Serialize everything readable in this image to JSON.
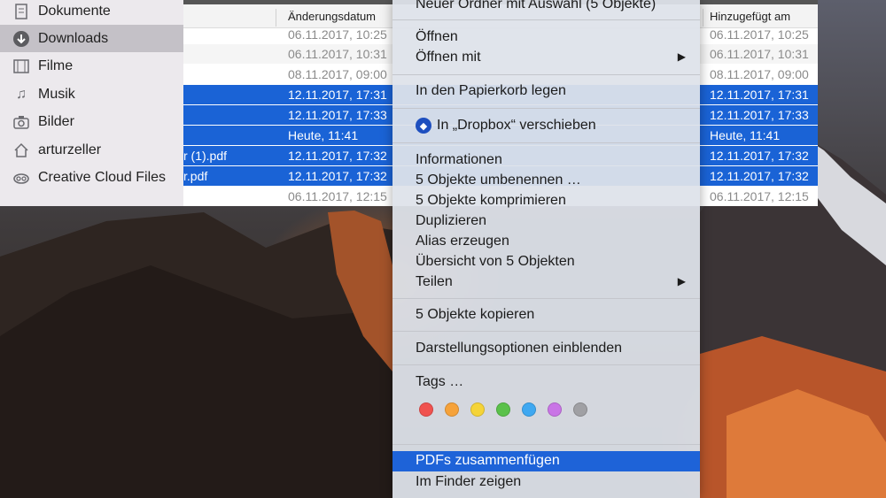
{
  "sidebar": {
    "items": [
      {
        "label": "Dokumente",
        "icon": "document-icon",
        "active": false
      },
      {
        "label": "Downloads",
        "icon": "download-icon",
        "active": true
      },
      {
        "label": "Filme",
        "icon": "film-icon",
        "active": false
      },
      {
        "label": "Musik",
        "icon": "music-icon",
        "active": false
      },
      {
        "label": "Bilder",
        "icon": "camera-icon",
        "active": false
      },
      {
        "label": "arturzeller",
        "icon": "home-icon",
        "active": false
      },
      {
        "label": "Creative Cloud Files",
        "icon": "creative-cloud-icon",
        "active": false
      }
    ]
  },
  "filelist": {
    "columns": {
      "modified": "Änderungsdatum",
      "added": "Hinzugefügt am"
    },
    "rows": [
      {
        "name": "",
        "modified": "06.11.2017, 10:25",
        "added": "06.11.2017, 10:25",
        "selected": false
      },
      {
        "name": "",
        "modified": "06.11.2017, 10:31",
        "added": "06.11.2017, 10:31",
        "selected": false
      },
      {
        "name": "",
        "modified": "08.11.2017, 09:00",
        "added": "08.11.2017, 09:00",
        "selected": false
      },
      {
        "name": "",
        "modified": "12.11.2017, 17:31",
        "added": "12.11.2017, 17:31",
        "selected": true
      },
      {
        "name": "",
        "modified": "12.11.2017, 17:33",
        "added": "12.11.2017, 17:33",
        "selected": true
      },
      {
        "name": "",
        "modified": "Heute, 11:41",
        "added": "Heute, 11:41",
        "selected": true
      },
      {
        "name": "r (1).pdf",
        "modified": "12.11.2017, 17:32",
        "added": "12.11.2017, 17:32",
        "selected": true
      },
      {
        "name": "r.pdf",
        "modified": "12.11.2017, 17:32",
        "added": "12.11.2017, 17:32",
        "selected": true
      },
      {
        "name": "",
        "modified": "06.11.2017, 12:15",
        "added": "06.11.2017, 12:15",
        "selected": false
      }
    ]
  },
  "menu": {
    "new_folder": "Neuer Ordner mit Auswahl (5 Objekte)",
    "open": "Öffnen",
    "open_with": "Öffnen mit",
    "trash": "In den Papierkorb legen",
    "dropbox": "In „Dropbox“ verschieben",
    "info": "Informationen",
    "rename": "5 Objekte umbenennen …",
    "compress": "5 Objekte komprimieren",
    "duplicate": "Duplizieren",
    "alias": "Alias erzeugen",
    "overview": "Übersicht von 5 Objekten",
    "share": "Teilen",
    "copy": "5 Objekte kopieren",
    "view_options": "Darstellungsoptionen einblenden",
    "tags": "Tags …",
    "tag_colors": [
      {
        "name": "red",
        "color": "#f0524f"
      },
      {
        "name": "orange",
        "color": "#f6a23a"
      },
      {
        "name": "yellow",
        "color": "#f5d438"
      },
      {
        "name": "green",
        "color": "#5ac14a"
      },
      {
        "name": "blue",
        "color": "#3fa8f1"
      },
      {
        "name": "purple",
        "color": "#c975e6"
      },
      {
        "name": "gray",
        "color": "#a0a0a4"
      }
    ],
    "merge_pdfs": "PDFs zusammenfügen",
    "show_in_finder": "Im Finder zeigen"
  },
  "colors": {
    "selection": "#1a63d6",
    "menu_highlight": "#1e63d8"
  }
}
